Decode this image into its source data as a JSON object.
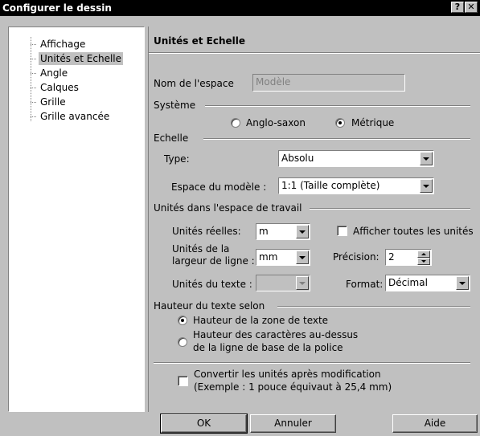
{
  "window": {
    "title": "Configurer le dessin",
    "help_glyph": "?",
    "close_glyph": "✕"
  },
  "tree": {
    "items": [
      {
        "label": "Affichage"
      },
      {
        "label": "Unités et Echelle",
        "selected": true
      },
      {
        "label": "Angle"
      },
      {
        "label": "Calques"
      },
      {
        "label": "Grille"
      },
      {
        "label": "Grille avancée"
      }
    ]
  },
  "panel": {
    "title": "Unités et Echelle",
    "space_name": {
      "label": "Nom de l'espace",
      "value": "Modèle"
    },
    "system": {
      "section": "Système",
      "anglo": "Anglo-saxon",
      "metric": "Métrique",
      "selected": "metric"
    },
    "scale": {
      "section": "Echelle",
      "type_label": "Type:",
      "type_value": "Absolu",
      "model_space_label": "Espace du modèle :",
      "model_space_value": "1:1 (Taille complète)"
    },
    "workspace_units": {
      "section": "Unités dans l'espace de travail",
      "real_units_label": "Unités réelles:",
      "real_units_value": "m",
      "show_all_label": "Afficher toutes les unités",
      "line_width_label_1": "Unités de la",
      "line_width_label_2": "largeur de ligne :",
      "line_width_value": "mm",
      "precision_label": "Précision:",
      "precision_value": "2",
      "text_units_label": "Unités du texte :",
      "format_label": "Format:",
      "format_value": "Décimal"
    },
    "text_height": {
      "section": "Hauteur du texte selon",
      "option1": "Hauteur de la zone de texte",
      "option2_line1": "Hauteur des caractères au-dessus",
      "option2_line2": "de la ligne de base de la police",
      "selected": "option1"
    },
    "convert": {
      "line1": "Convertir les unités après modification",
      "line2": "(Exemple : 1 pouce équivaut à 25,4 mm)"
    }
  },
  "buttons": {
    "ok": "OK",
    "cancel": "Annuler",
    "help": "Aide"
  }
}
